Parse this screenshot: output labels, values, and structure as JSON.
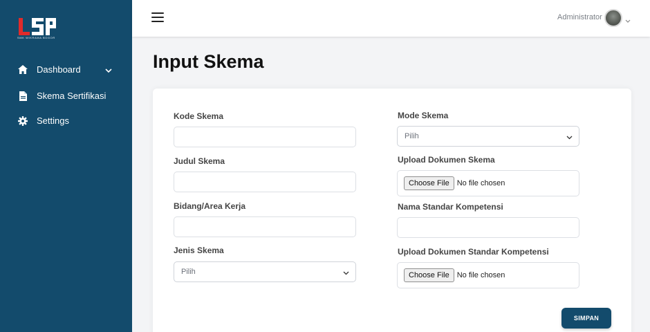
{
  "brand": {
    "logo_text": "LSP",
    "logo_sub": "SMK WIKRAMA BOGOR",
    "accent": "#134b6c",
    "logo_red": "#e02b2b"
  },
  "sidebar": {
    "items": [
      {
        "label": "Dashboard",
        "icon": "home-icon",
        "has_chevron": true
      },
      {
        "label": "Skema Sertifikasi",
        "icon": "file-icon"
      },
      {
        "label": "Settings",
        "icon": "gear-icon"
      }
    ]
  },
  "topbar": {
    "user_name": "Administrator"
  },
  "page": {
    "title": "Input Skema"
  },
  "form": {
    "kode_skema": {
      "label": "Kode Skema",
      "value": ""
    },
    "judul_skema": {
      "label": "Judul Skema",
      "value": ""
    },
    "bidang": {
      "label": "Bidang/Area Kerja",
      "value": ""
    },
    "jenis_skema": {
      "label": "Jenis Skema",
      "selected": "Pilih"
    },
    "mode_skema": {
      "label": "Mode Skema",
      "selected": "Pilih"
    },
    "upload_skema": {
      "label": "Upload Dokumen Skema",
      "button": "Choose File",
      "status": "No file chosen"
    },
    "nama_standar": {
      "label": "Nama Standar Kompetensi",
      "value": ""
    },
    "upload_standar": {
      "label": "Upload Dokumen Standar Kompetensi",
      "button": "Choose File",
      "status": "No file chosen"
    },
    "submit_label": "SIMPAN"
  }
}
